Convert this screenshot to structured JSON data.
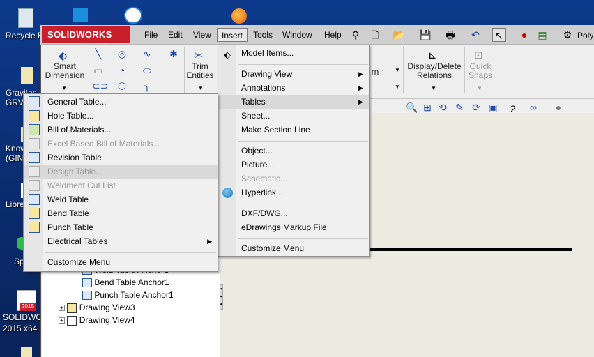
{
  "desktop": {
    "icons": [
      {
        "label": "Recycle B",
        "name": "recycle-bin"
      },
      {
        "label": "Gravitas a",
        "name": "gravitas"
      },
      {
        "label": "GRV",
        "name": "grv"
      },
      {
        "label": "Know",
        "name": "know"
      },
      {
        "label": "(GIN",
        "name": "gin"
      },
      {
        "label": "Libre",
        "name": "libre"
      },
      {
        "label": "Sp",
        "name": "sp"
      },
      {
        "label": "SOLIDWO",
        "name": "solidworks-shortcut"
      },
      {
        "label": "2015 x64 E",
        "name": "solidworks-version"
      }
    ],
    "badge_2015": "2015"
  },
  "app": {
    "logo": "SOLIDWORKS",
    "menu": [
      "File",
      "Edit",
      "View",
      "Insert",
      "Tools",
      "Window",
      "Help"
    ],
    "poly_label": "Poly"
  },
  "ribbon": {
    "smart_dimension": [
      "Smart",
      "Dimension"
    ],
    "trim_entities": [
      "Trim",
      "Entities"
    ],
    "display_delete": [
      "Display/Delete",
      "Relations"
    ],
    "quick_snaps": [
      "Quick",
      "Snaps"
    ],
    "partial_rn": "rn"
  },
  "viewbar": {
    "number": "2"
  },
  "insert_menu": [
    {
      "label": "Model Items...",
      "has_icon": true
    },
    {
      "sep": true
    },
    {
      "label": "Drawing View",
      "arrow": true
    },
    {
      "label": "Annotations",
      "arrow": true
    },
    {
      "label": "Tables",
      "arrow": true,
      "highlight": true
    },
    {
      "label": "Sheet..."
    },
    {
      "label": "Make Section Line"
    },
    {
      "sep": true
    },
    {
      "label": "Object..."
    },
    {
      "label": "Picture..."
    },
    {
      "label": "Schematic...",
      "disabled": true
    },
    {
      "label": "Hyperlink...",
      "has_icon": true
    },
    {
      "sep": true
    },
    {
      "label": "DXF/DWG..."
    },
    {
      "label": "eDrawings Markup File"
    },
    {
      "sep": true
    },
    {
      "label": "Customize Menu"
    }
  ],
  "tables_menu": [
    {
      "label": "General Table...",
      "icon": "general-table"
    },
    {
      "label": "Hole Table...",
      "icon": "hole-table"
    },
    {
      "label": "Bill of Materials...",
      "icon": "bom"
    },
    {
      "label": "Excel Based Bill of Materials...",
      "icon": "excel-bom",
      "disabled": true
    },
    {
      "label": "Revision Table",
      "icon": "revision-table"
    },
    {
      "label": "Design Table...",
      "icon": "design-table",
      "disabled": true,
      "highlight": true
    },
    {
      "label": "Weldment Cut List",
      "icon": "weldment-cut-list",
      "disabled": true
    },
    {
      "label": "Weld Table",
      "icon": "weld-table"
    },
    {
      "label": "Bend Table",
      "icon": "bend-table"
    },
    {
      "label": "Punch Table",
      "icon": "punch-table"
    },
    {
      "label": "Electrical Tables",
      "arrow": true
    },
    {
      "sep": true
    },
    {
      "label": "Customize Menu"
    }
  ],
  "tree": [
    {
      "label": "Weld Table Anchor1",
      "indent": 1
    },
    {
      "label": "Bend Table Anchor1",
      "indent": 1
    },
    {
      "label": "Punch Table Anchor1",
      "indent": 1
    },
    {
      "label": "Drawing View3",
      "indent": 0,
      "expand": "+"
    },
    {
      "label": "Drawing View4",
      "indent": 0,
      "expand": "+"
    }
  ]
}
